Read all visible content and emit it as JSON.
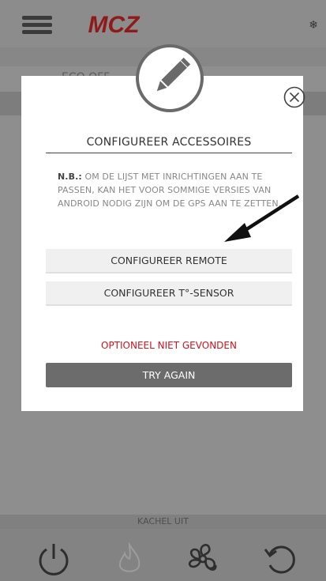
{
  "app": {
    "logo_text": "MCZ",
    "snow_icon": "snowflake-icon",
    "band_left": "ECO OFF",
    "band_right": "",
    "status_text": "KACHEL UIT",
    "bottom_icons": [
      "power-icon",
      "flame-icon",
      "fan-icon",
      "refresh-icon"
    ]
  },
  "modal": {
    "title": "CONFIGUREER ACCESSOIRES",
    "note_bold": "N.B.:",
    "note_text": " OM DE LIJST MET INRICHTINGEN AAN TE PASSEN, KAN HET VOOR SOMMIGE VERSIES VAN ANDROID NODIG ZIJN OM DE GPS AAN TE ZETTEN.",
    "buttons": {
      "remote": "CONFIGUREER REMOTE",
      "sensor": "CONFIGUREER T°-SENSOR"
    },
    "warning": "OPTIONEEL NIET GEVONDEN",
    "try_again": "TRY AGAIN"
  },
  "colors": {
    "accent_red": "#d4111b",
    "dark_button": "#6c6c6c",
    "overlay_gray": "#8c8c8c"
  }
}
